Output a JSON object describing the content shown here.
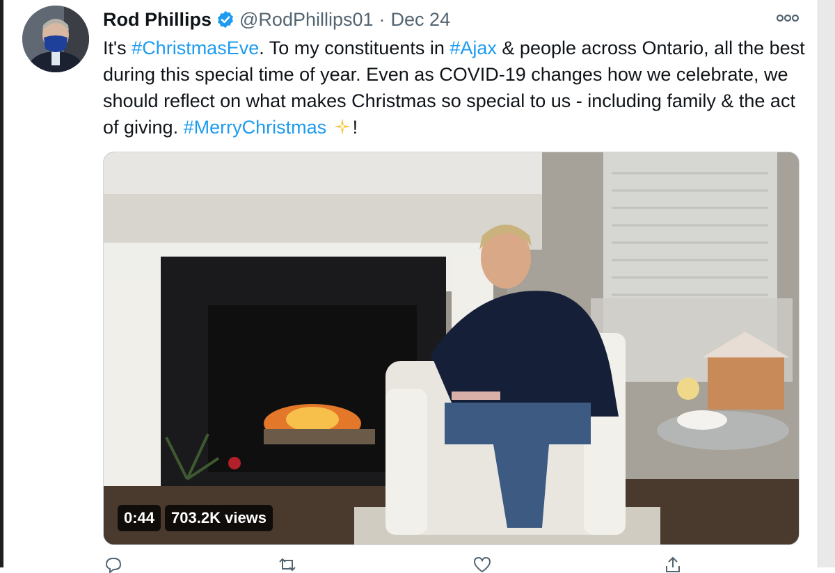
{
  "tweet": {
    "display_name": "Rod Phillips",
    "handle": "@RodPhillips01",
    "separator": "·",
    "date": "Dec 24",
    "text_parts": [
      {
        "t": "It's ",
        "tag": false
      },
      {
        "t": "#ChristmasEve",
        "tag": true
      },
      {
        "t": ". To my constituents in ",
        "tag": false
      },
      {
        "t": "#Ajax",
        "tag": true
      },
      {
        "t": " & people across Ontario, all the best during this special time of year. Even as COVID-19 changes how we celebrate, we should reflect on what makes Christmas so special to us - including family & the act of giving. ",
        "tag": false
      },
      {
        "t": "#MerryChristmas",
        "tag": true
      }
    ],
    "text_end": "!",
    "icons": {
      "verified": "verified-badge-icon",
      "more": "more-options-icon",
      "sparkle": "sparkle-emoji-icon"
    }
  },
  "video": {
    "duration": "0:44",
    "views": "703.2K views"
  },
  "colors": {
    "link": "#1d9bf0",
    "text": "#0f1419",
    "muted": "#536471"
  }
}
